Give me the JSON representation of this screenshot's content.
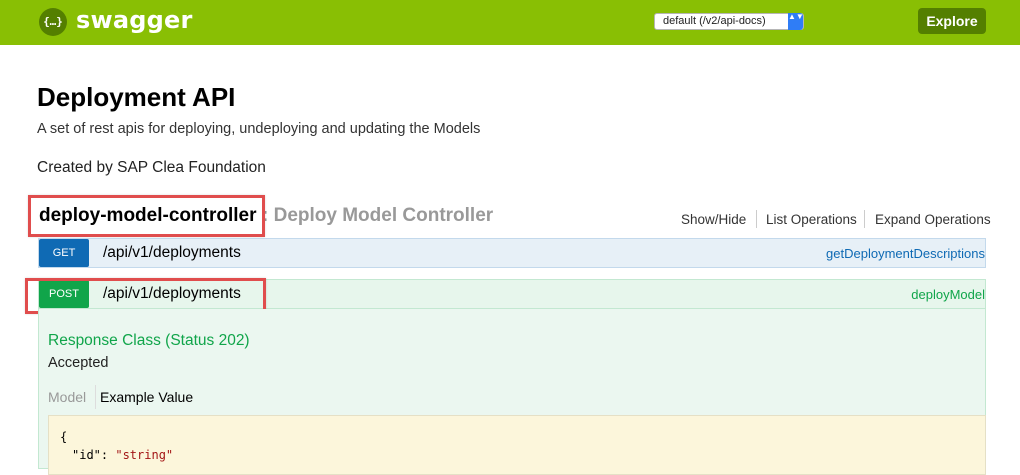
{
  "header": {
    "logo_glyph": "{…}",
    "brand": "swagger",
    "spec_select": {
      "value": "default (/v2/api-docs)",
      "arrows": "▲▼"
    },
    "explore_label": "Explore",
    "colors": {
      "bar": "#89bf04",
      "accent": "#547f00"
    }
  },
  "info": {
    "title": "Deployment API",
    "description": "A set of rest apis for deploying, undeploying and updating the Models",
    "created_by": "Created by SAP Clea Foundation"
  },
  "resource": {
    "name": "deploy-model-controller",
    "subtitle": ": Deploy Model Controller",
    "actions": {
      "show_hide": "Show/Hide",
      "list_operations": "List Operations",
      "expand_operations": "Expand Operations"
    }
  },
  "operations": [
    {
      "method": "GET",
      "path": "/api/v1/deployments",
      "nickname": "getDeploymentDescriptions",
      "color": "#0f6ab4"
    },
    {
      "method": "POST",
      "path": "/api/v1/deployments",
      "nickname": "deployModel",
      "color": "#10a54a"
    }
  ],
  "post_details": {
    "response_class": "Response Class (Status 202)",
    "response_desc": "Accepted",
    "tabs": {
      "model": "Model",
      "example": "Example Value"
    },
    "code_lines": {
      "open": "{",
      "key": "\"id\": ",
      "value": "\"string\""
    }
  }
}
